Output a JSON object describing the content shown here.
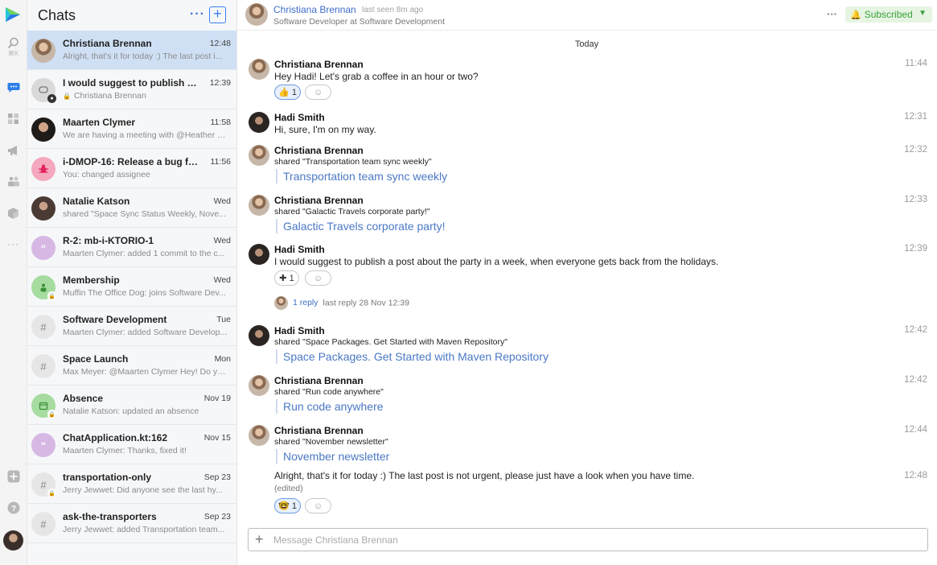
{
  "rail": {
    "search_shortcut": "⌘K",
    "icons": [
      "search-icon",
      "chats-icon",
      "apps-icon",
      "megaphone-icon",
      "team-icon",
      "package-icon",
      "more-icon",
      "add-icon",
      "help-icon",
      "profile-avatar"
    ]
  },
  "list": {
    "title": "Chats",
    "more_label": "···",
    "new_label": "+",
    "items": [
      {
        "name": "Christiana Brennan",
        "time": "12:48",
        "preview": "Alright, that's it for today :) The last post i..."
      },
      {
        "name": "I would suggest to publish a p...",
        "time": "12:39",
        "preview": "Christiana Brennan"
      },
      {
        "name": "Maarten Clymer",
        "time": "11:58",
        "preview": "We are having a meeting with @Heather S..."
      },
      {
        "name": "i-DMOP-16: Release a bug fix ...",
        "time": "11:56",
        "preview": "You: changed assignee"
      },
      {
        "name": "Natalie Katson",
        "time": "Wed",
        "preview": "shared \"Space Sync Status Weekly, Nove..."
      },
      {
        "name": "R-2: mb-i-KTORIO-1",
        "time": "Wed",
        "preview": "Maarten Clymer: added 1 commit to the c..."
      },
      {
        "name": "Membership",
        "time": "Wed",
        "preview": "Muffin The Office Dog: joins Software Dev..."
      },
      {
        "name": "Software Development",
        "time": "Tue",
        "preview": "Maarten Clymer: added Software Develop..."
      },
      {
        "name": "Space Launch",
        "time": "Mon",
        "preview": "Max Meyer: @Maarten Clymer Hey! Do yo..."
      },
      {
        "name": "Absence",
        "time": "Nov 19",
        "preview": "Natalie Katson: updated an absence"
      },
      {
        "name": "ChatApplication.kt:162",
        "time": "Nov 15",
        "preview": "Maarten Clymer: Thanks, fixed it!"
      },
      {
        "name": "transportation-only",
        "time": "Sep 23",
        "preview": "Jerry Jewwet: Did anyone see the last hy..."
      },
      {
        "name": "ask-the-transporters",
        "time": "Sep 23",
        "preview": "Jerry Jewwet: added Transportation team..."
      }
    ]
  },
  "header": {
    "name": "Christiana Brennan",
    "last_seen": "last seen 8m ago",
    "role": "Software Developer at Software Development",
    "more_label": "···",
    "subscribe_label": "Subscribed"
  },
  "conversation": {
    "day": "Today",
    "messages": [
      {
        "author": "Christiana Brennan",
        "time": "11:44",
        "text": "Hey Hadi! Let's grab a coffee in an hour or two?",
        "reaction": "👍 1"
      },
      {
        "author": "Hadi Smith",
        "time": "12:31",
        "text": "Hi, sure, I'm on my way."
      },
      {
        "author": "Christiana Brennan",
        "time": "12:32",
        "shared": "shared \"Transportation team sync weekly\"",
        "link": "Transportation team sync weekly"
      },
      {
        "author": "Christiana Brennan",
        "time": "12:33",
        "shared": "shared \"Galactic Travels corporate party!\"",
        "link": "Galactic Travels corporate party!"
      },
      {
        "author": "Hadi Smith",
        "time": "12:39",
        "text": "I would suggest to publish a post about the party in a week, when everyone gets back from the holidays.",
        "reaction": "✚ 1",
        "reply_count": "1 reply",
        "last_reply": "last reply 28 Nov 12:39"
      },
      {
        "author": "Hadi Smith",
        "time": "12:42",
        "shared": "shared \"Space Packages. Get Started with Maven Repository\"",
        "link": "Space Packages. Get Started with Maven Repository"
      },
      {
        "author": "Christiana Brennan",
        "time": "12:42",
        "shared": "shared \"Run code anywhere\"",
        "link": "Run code anywhere"
      },
      {
        "author": "Christiana Brennan",
        "time": "12:44",
        "shared": "shared \"November newsletter\"",
        "link": "November newsletter"
      },
      {
        "time": "12:48",
        "text": "Alright, that's it for today :) The last post is not urgent, please just have a look when you have time.",
        "edited": "(edited)",
        "reaction": "🤓 1"
      }
    ]
  },
  "composer": {
    "placeholder": "Message Christiana Brennan"
  },
  "colors": {
    "accent": "#3b7ef0",
    "active_row": "#cfe0f5",
    "link": "#4a78c5",
    "subscribed_green": "#3aa23b"
  }
}
